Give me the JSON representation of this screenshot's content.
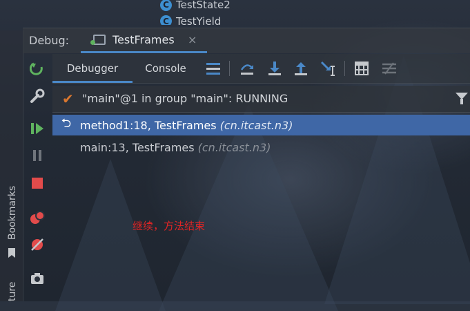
{
  "file_list": [
    {
      "name": "TestState2"
    },
    {
      "name": "TestYield"
    }
  ],
  "debug_panel": {
    "label": "Debug:",
    "tab": {
      "label": "TestFrames",
      "close": "×"
    }
  },
  "sub_toolbar": {
    "tabs": [
      {
        "label": "Debugger"
      },
      {
        "label": "Console"
      }
    ]
  },
  "thread": {
    "status_text": "\"main\"@1 in group \"main\": RUNNING"
  },
  "frames": [
    {
      "method": "method1:18, TestFrames",
      "package": "(cn.itcast.n3)",
      "selected": true
    },
    {
      "method": "main:13, TestFrames",
      "package": "(cn.itcast.n3)",
      "selected": false
    }
  ],
  "side_tabs": {
    "bookmarks": "Bookmarks",
    "structure": "ture"
  },
  "annotation": "继续，方法结束",
  "icons": [
    "rerun-icon",
    "settings-wrench-icon",
    "resume-icon",
    "pause-icon",
    "stop-icon",
    "view-breakpoints-icon",
    "mute-breakpoints-icon",
    "camera-icon",
    "show-execution-point-icon",
    "step-over-icon",
    "step-into-icon",
    "step-out-icon",
    "run-to-cursor-icon",
    "evaluate-expression-icon",
    "trace-icon",
    "filter-icon",
    "bookmark-icon",
    "return-icon"
  ],
  "colors": {
    "accent_blue": "#4a88c7",
    "selection": "#3f67a6",
    "running_check": "#d9772f",
    "annotation_red": "#e02525"
  }
}
